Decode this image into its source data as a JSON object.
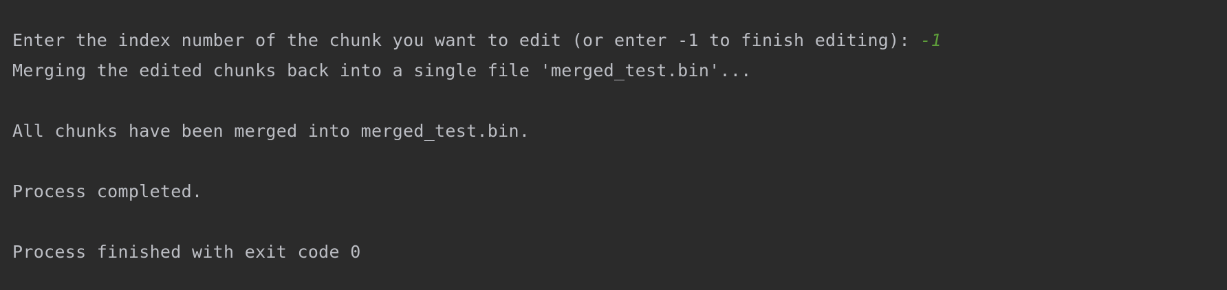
{
  "console": {
    "lines": [
      {
        "text": "Enter the index number of the chunk you want to edit (or enter -1 to finish editing): ",
        "input": "-1"
      },
      {
        "text": "Merging the edited chunks back into a single file 'merged_test.bin'..."
      },
      {
        "text": "All chunks have been merged into merged_test.bin."
      },
      {
        "text": "Process completed."
      },
      {
        "text": "Process finished with exit code 0"
      }
    ],
    "colors": {
      "background": "#2b2b2b",
      "text": "#bcbec4",
      "user_input": "#5e9e3a"
    }
  }
}
